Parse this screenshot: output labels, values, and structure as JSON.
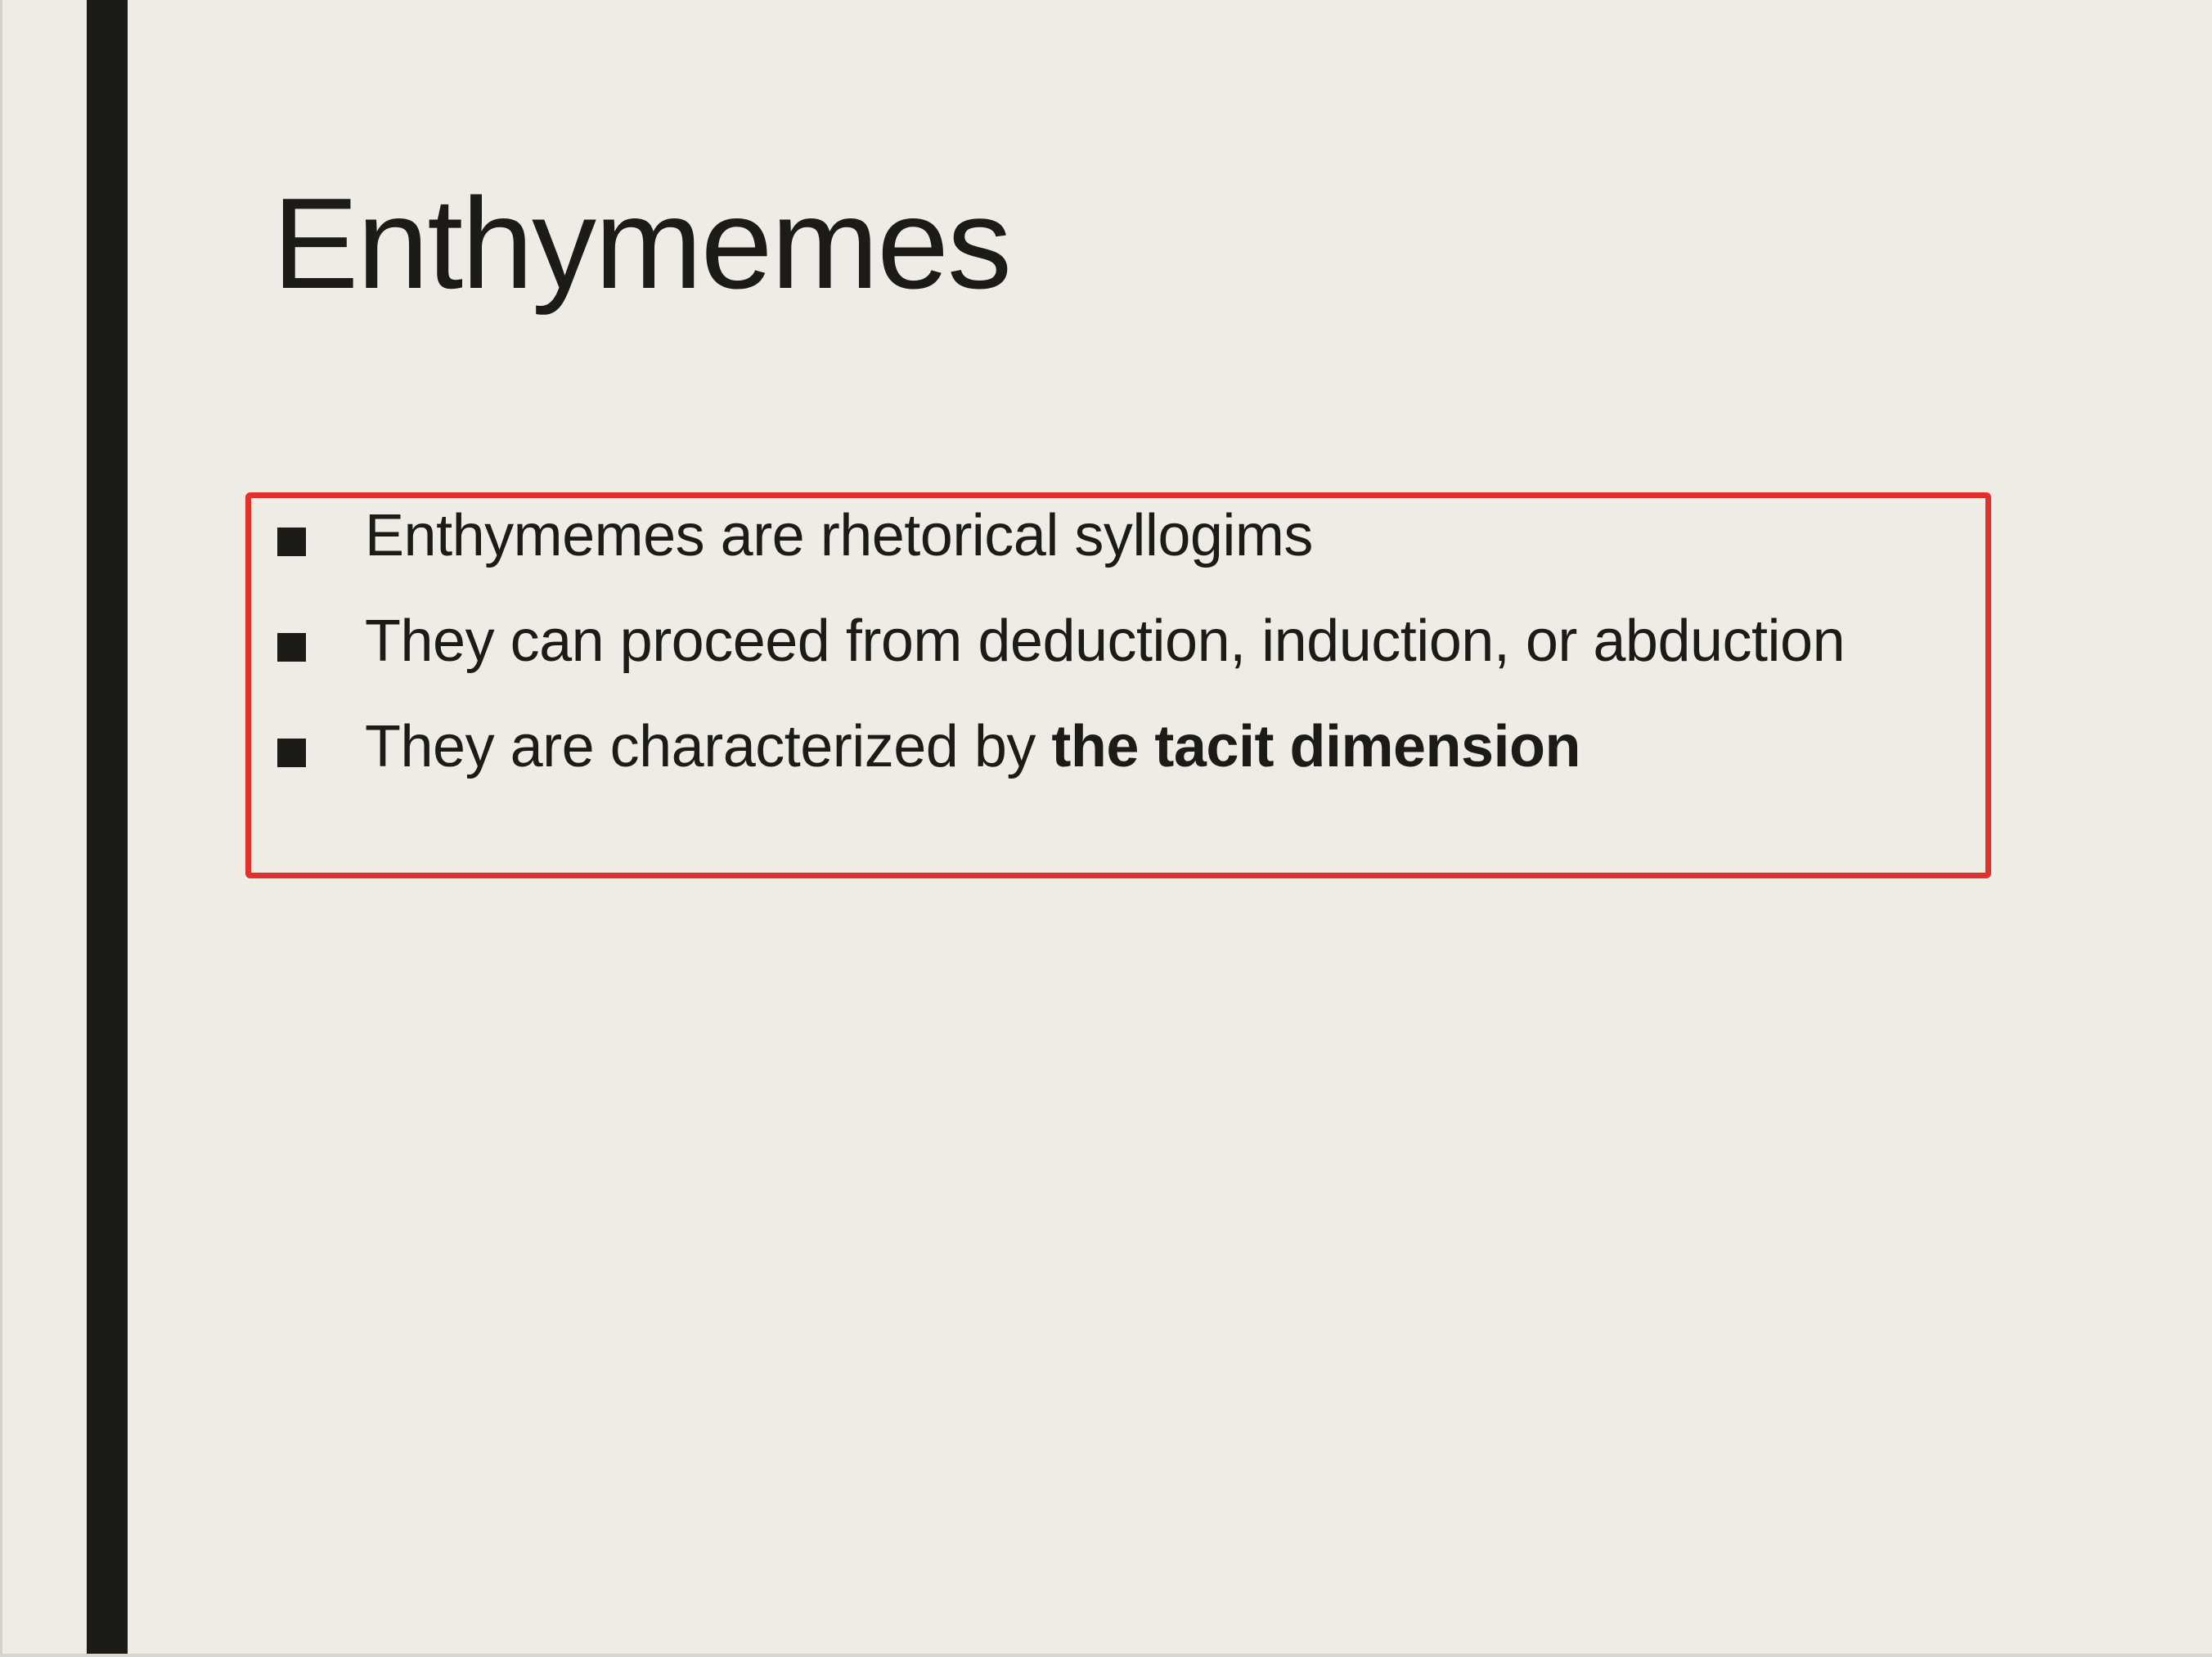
{
  "slide": {
    "title": "Enthymemes",
    "bullets": [
      {
        "text": "Enthymemes are rhetorical syllogims"
      },
      {
        "text": "They can proceed from deduction, induction, or abduction"
      },
      {
        "text_prefix": "They are characterized by ",
        "text_emphasis": "the tacit dimension"
      }
    ],
    "bullet_icon": "square-bullet-icon",
    "colors": {
      "background": "#efece6",
      "left_bar": "#1c1b16",
      "highlight_border": "#e0312c",
      "text": "#1c1b17"
    }
  }
}
